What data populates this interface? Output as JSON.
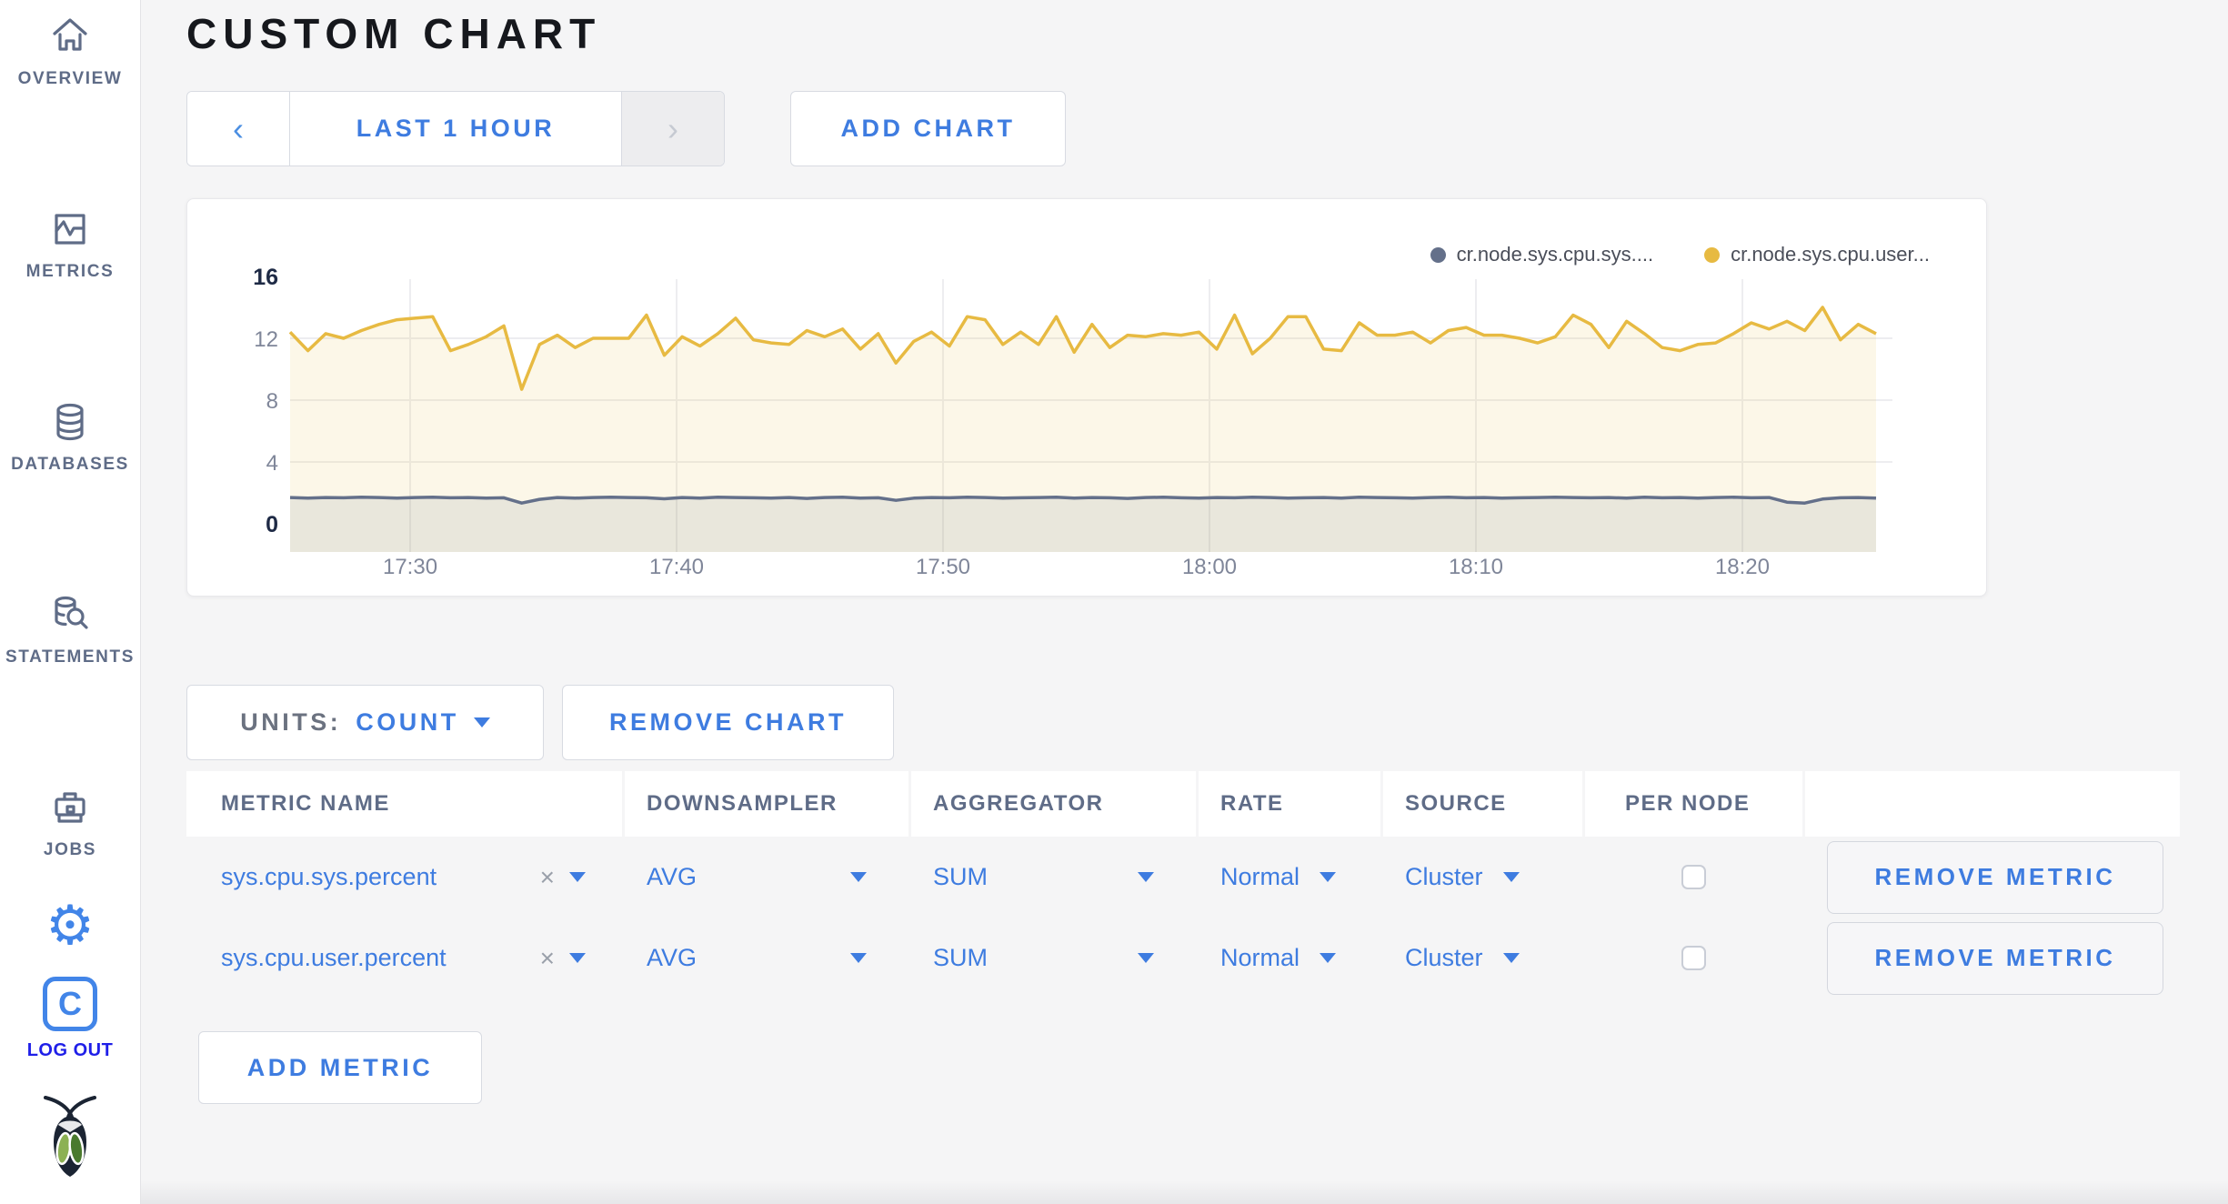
{
  "colors": {
    "accent_blue": "#3e7ce0",
    "series_user": "#e7ba42",
    "series_sys": "#64708a",
    "grid": "#ededf0",
    "user_fill": "rgba(231,186,66,0.12)",
    "sys_fill": "rgba(100,112,138,0.12)"
  },
  "sidebar": {
    "items": [
      {
        "label": "OVERVIEW",
        "icon": "home-icon"
      },
      {
        "label": "METRICS",
        "icon": "metrics-icon"
      },
      {
        "label": "DATABASES",
        "icon": "database-icon"
      },
      {
        "label": "STATEMENTS",
        "icon": "statements-icon"
      },
      {
        "label": "JOBS",
        "icon": "briefcase-icon"
      }
    ],
    "settings_icon": "gear-icon",
    "logout_label": "LOG OUT",
    "logo": "cockroach-bug-logo"
  },
  "header": {
    "title": "CUSTOM CHART"
  },
  "toolbar": {
    "time_range_label": "LAST 1 HOUR",
    "add_chart_label": "ADD CHART"
  },
  "chart_data": {
    "type": "area",
    "title": "",
    "xlabel": "",
    "ylabel": "",
    "ylim": [
      0,
      16
    ],
    "yticks": [
      0,
      4,
      8,
      12,
      16
    ],
    "grid": true,
    "legend_position": "top-right",
    "x_ticks": [
      {
        "label": "17:30",
        "frac": 0.0757
      },
      {
        "label": "17:40",
        "frac": 0.2437
      },
      {
        "label": "17:50",
        "frac": 0.4117
      },
      {
        "label": "18:00",
        "frac": 0.5797
      },
      {
        "label": "18:10",
        "frac": 0.7477
      },
      {
        "label": "18:20",
        "frac": 0.9157
      }
    ],
    "series": [
      {
        "name": "cr.node.sys.cpu.user...",
        "color": "#e7ba42",
        "values": [
          12.4,
          11.2,
          12.3,
          12.0,
          12.5,
          12.9,
          13.2,
          13.3,
          13.4,
          11.2,
          11.6,
          12.1,
          12.8,
          8.7,
          11.6,
          12.2,
          11.4,
          12.0,
          12.0,
          12.0,
          13.5,
          10.9,
          12.1,
          11.5,
          12.3,
          13.3,
          11.9,
          11.7,
          11.6,
          12.5,
          12.1,
          12.6,
          11.3,
          12.3,
          10.4,
          11.8,
          12.4,
          11.5,
          13.4,
          13.2,
          11.6,
          12.4,
          11.6,
          13.4,
          11.1,
          12.9,
          11.4,
          12.2,
          12.1,
          12.3,
          12.2,
          12.4,
          11.3,
          13.5,
          11.0,
          12.0,
          13.4,
          13.4,
          11.3,
          11.2,
          13.0,
          12.2,
          12.2,
          12.4,
          11.7,
          12.5,
          12.7,
          12.2,
          12.2,
          12.0,
          11.7,
          12.1,
          13.5,
          12.9,
          11.4,
          13.1,
          12.3,
          11.4,
          11.2,
          11.6,
          11.7,
          12.3,
          13.0,
          12.6,
          13.1,
          12.5,
          14.0,
          11.9,
          12.9,
          12.3
        ]
      },
      {
        "name": "cr.node.sys.cpu.sys....",
        "color": "#64708a",
        "values": [
          1.7,
          1.66,
          1.7,
          1.68,
          1.72,
          1.7,
          1.66,
          1.7,
          1.72,
          1.68,
          1.7,
          1.66,
          1.68,
          1.34,
          1.58,
          1.7,
          1.66,
          1.7,
          1.72,
          1.7,
          1.68,
          1.62,
          1.7,
          1.66,
          1.72,
          1.7,
          1.68,
          1.66,
          1.7,
          1.64,
          1.7,
          1.72,
          1.66,
          1.68,
          1.52,
          1.66,
          1.7,
          1.68,
          1.72,
          1.7,
          1.66,
          1.68,
          1.7,
          1.72,
          1.66,
          1.7,
          1.68,
          1.64,
          1.7,
          1.72,
          1.68,
          1.66,
          1.7,
          1.68,
          1.72,
          1.7,
          1.66,
          1.68,
          1.7,
          1.66,
          1.72,
          1.7,
          1.68,
          1.66,
          1.7,
          1.72,
          1.68,
          1.7,
          1.66,
          1.68,
          1.7,
          1.72,
          1.7,
          1.68,
          1.7,
          1.66,
          1.72,
          1.68,
          1.7,
          1.66,
          1.7,
          1.72,
          1.68,
          1.7,
          1.4,
          1.34,
          1.6,
          1.68,
          1.7,
          1.66
        ]
      }
    ],
    "legend": [
      {
        "label": "cr.node.sys.cpu.sys....",
        "color": "#64708a"
      },
      {
        "label": "cr.node.sys.cpu.user...",
        "color": "#e7ba42"
      }
    ]
  },
  "controls": {
    "units_label": "UNITS:",
    "units_value": "COUNT",
    "remove_chart_label": "REMOVE CHART",
    "add_metric_label": "ADD METRIC"
  },
  "table": {
    "columns": [
      "METRIC NAME",
      "DOWNSAMPLER",
      "AGGREGATOR",
      "RATE",
      "SOURCE",
      "PER NODE",
      ""
    ],
    "rows": [
      {
        "metric": "sys.cpu.sys.percent",
        "downsampler": "AVG",
        "aggregator": "SUM",
        "rate": "Normal",
        "source": "Cluster",
        "per_node": false,
        "remove_label": "REMOVE METRIC"
      },
      {
        "metric": "sys.cpu.user.percent",
        "downsampler": "AVG",
        "aggregator": "SUM",
        "rate": "Normal",
        "source": "Cluster",
        "per_node": false,
        "remove_label": "REMOVE METRIC"
      }
    ]
  }
}
